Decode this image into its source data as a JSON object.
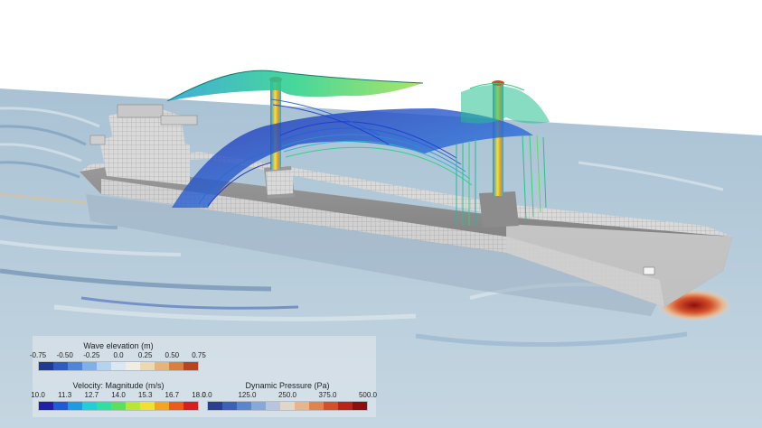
{
  "legends": {
    "wave": {
      "title": "Wave elevation (m)",
      "ticks": [
        "-0.75",
        "-0.50",
        "-0.25",
        "0.0",
        "0.25",
        "0.50",
        "0.75"
      ],
      "colors": [
        "#1f3a8f",
        "#2f5cc0",
        "#4f86da",
        "#7fb0ea",
        "#b4d3f1",
        "#dbe8f3",
        "#f2ede2",
        "#ecd9b0",
        "#e6b478",
        "#d8803e",
        "#b84520"
      ]
    },
    "velocity": {
      "title": "Velocity: Magnitude (m/s)",
      "ticks": [
        "10.0",
        "11.3",
        "12.7",
        "14.0",
        "15.3",
        "16.7",
        "18.0"
      ],
      "colors": [
        "#1f1fa8",
        "#1f5ad8",
        "#1f9be6",
        "#1fd0d6",
        "#2fe0a0",
        "#5be05a",
        "#b8e632",
        "#f0e030",
        "#f4a420",
        "#ee5a1a",
        "#d81e1e"
      ]
    },
    "pressure": {
      "title": "Dynamic Pressure (Pa)",
      "ticks": [
        "0.0",
        "125.0",
        "250.0",
        "375.0",
        "500.0"
      ],
      "colors": [
        "#2a3f8e",
        "#3b62b8",
        "#5a86d0",
        "#86aad8",
        "#b6c6de",
        "#e2d6c8",
        "#e8b48a",
        "#e2834e",
        "#d4502a",
        "#b82418",
        "#8e0e0e"
      ]
    }
  }
}
